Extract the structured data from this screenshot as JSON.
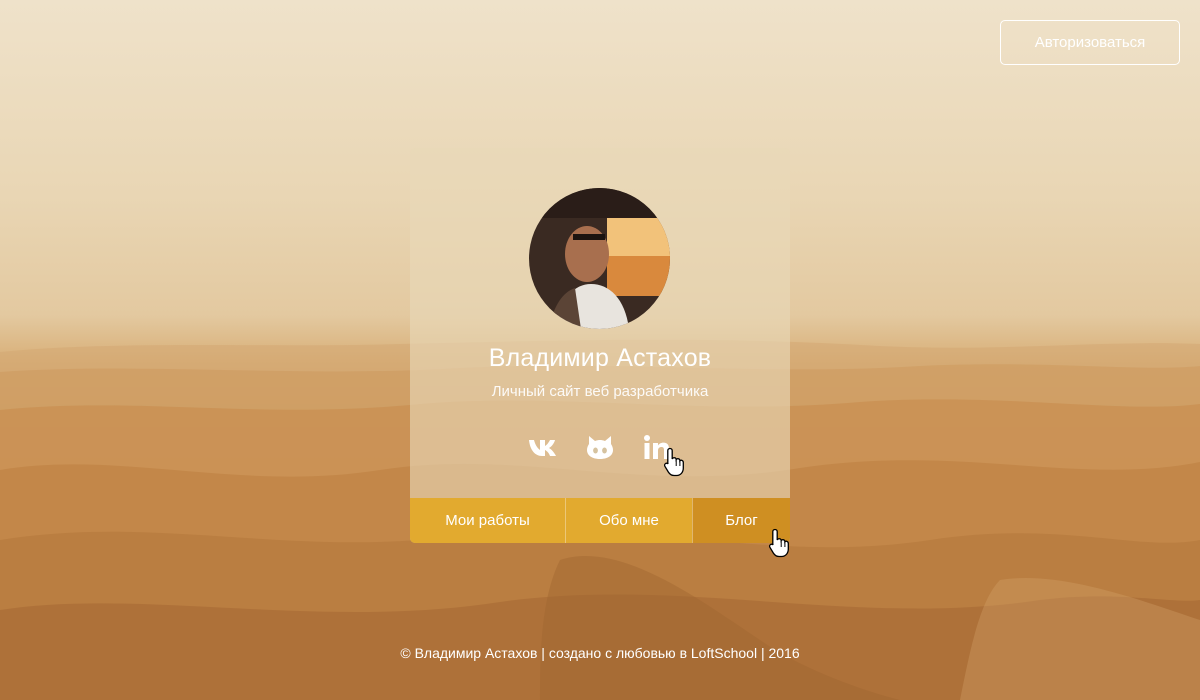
{
  "header": {
    "auth_button_label": "Авторизоваться"
  },
  "card": {
    "name": "Владимир Астахов",
    "subtitle": "Личный сайт веб разработчика",
    "avatar_icon": "user-photo",
    "socials": [
      {
        "name": "vk",
        "icon": "vk-icon"
      },
      {
        "name": "github",
        "icon": "github-icon"
      },
      {
        "name": "linkedin",
        "icon": "linkedin-icon",
        "glyph": "in"
      }
    ],
    "nav": [
      {
        "label": "Мои работы",
        "active": false
      },
      {
        "label": "Обо мне",
        "active": false
      },
      {
        "label": "Блог",
        "active": true
      }
    ]
  },
  "footer": {
    "text": "© Владимир Астахов | создано с любовью в LoftSchool | 2016"
  },
  "colors": {
    "nav_button": "#e2aa2f",
    "nav_button_active": "#cf8f22",
    "text": "#ffffff"
  }
}
